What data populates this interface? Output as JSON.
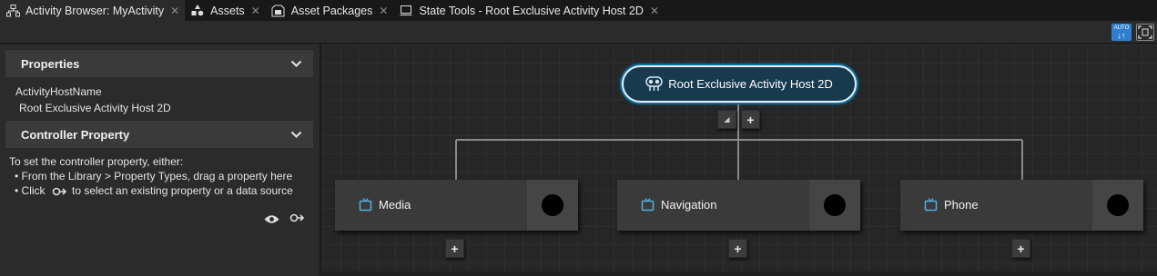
{
  "tabs": [
    {
      "label": "Activity Browser: MyActivity",
      "icon": "activity-browser-icon",
      "active": true
    },
    {
      "label": "Assets",
      "icon": "assets-icon",
      "active": false
    },
    {
      "label": "Asset Packages",
      "icon": "asset-packages-icon",
      "active": false
    },
    {
      "label": "State Tools - Root Exclusive Activity Host 2D",
      "icon": "state-tools-icon",
      "active": false
    }
  ],
  "toolbar": {
    "auto_label_top": "AUTO",
    "auto_label_bottom": "↓↑"
  },
  "properties": {
    "header": "Properties",
    "field_label": "ActivityHostName",
    "field_value": "Root Exclusive Activity Host 2D"
  },
  "controller": {
    "header": "Controller Property",
    "intro": "To set the controller property, either:",
    "bullet1": "• From the Library > Property Types, drag a property here",
    "bullet2_pre": "• Click",
    "bullet2_post": "to select an existing property or a data source"
  },
  "graph": {
    "root_label": "Root Exclusive Activity Host 2D",
    "collapse_glyph": "◢",
    "add_glyph": "+",
    "children": [
      {
        "label": "Media"
      },
      {
        "label": "Navigation"
      },
      {
        "label": "Phone"
      }
    ]
  },
  "colors": {
    "accent": "#2f7fd0",
    "root_fill": "#173a4f",
    "root_glow": "#0e6f9e",
    "node_icon": "#4fb3e0"
  }
}
